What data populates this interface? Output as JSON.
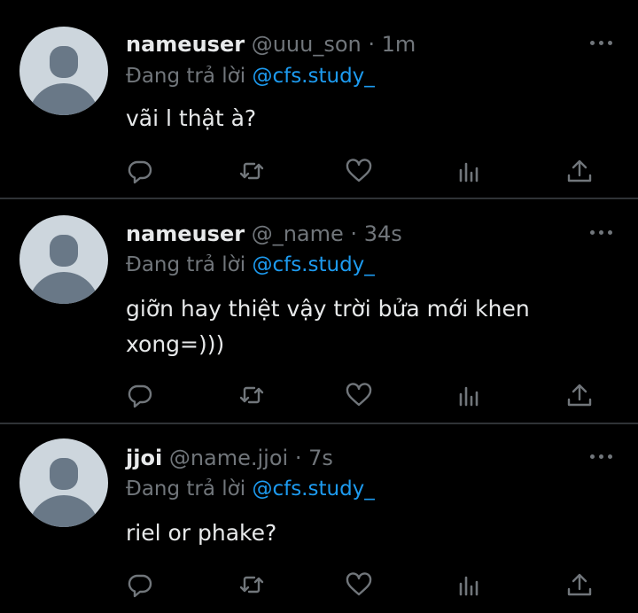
{
  "tweets": [
    {
      "name": "nameuser",
      "handle": "@uuu_son",
      "dot": "·",
      "time": "1m",
      "reply_prefix": "Đang trả lời",
      "reply_mention": "@cfs.study_",
      "text": "vãi l thật à?"
    },
    {
      "name": "nameuser",
      "handle": "@_name",
      "dot": "·",
      "time": "34s",
      "reply_prefix": "Đang trả lời",
      "reply_mention": "@cfs.study_",
      "text": "giỡn hay thiệt vậy trời bửa mới khen xong=)))"
    },
    {
      "name": "jjoi",
      "handle": "@name.jjoi",
      "dot": "·",
      "time": "7s",
      "reply_prefix": "Đang trả lời",
      "reply_mention": "@cfs.study_",
      "text": "riel or phake?"
    }
  ],
  "icons": {
    "reply": "reply-icon",
    "retweet": "retweet-icon",
    "like": "heart-icon",
    "views": "views-icon",
    "share": "share-icon",
    "more": "more-icon"
  },
  "colors": {
    "background": "#000000",
    "text": "#e7e9ea",
    "secondary": "#71767b",
    "mention": "#1d9bf0",
    "divider": "#2f3336",
    "avatar_bg": "#cdd6dd",
    "avatar_fg": "#697887"
  }
}
